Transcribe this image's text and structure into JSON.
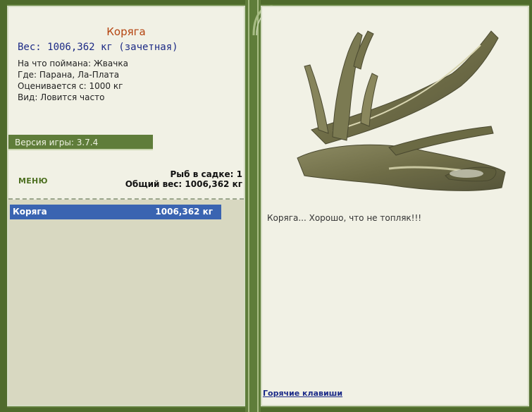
{
  "fish": {
    "title": "Коряга",
    "weight_line": "Вес: 1006,362 кг (зачетная)",
    "caught_on": "На что поймана: Жвачка",
    "location": "Где: Парана, Ла-Плата",
    "valued_from": "Оценивается с: 1000 кг",
    "frequency": "Вид: Ловится часто",
    "description": "Коряга... Хорошо, что не топляк!!!"
  },
  "version": {
    "label": "Версия игры: 3.7.4"
  },
  "menu": {
    "label": "МЕНЮ"
  },
  "keepnet": {
    "fish_count": "Рыб в садке: 1",
    "total_weight": "Общий вес: 1006,362 кг",
    "items": [
      {
        "name": "Коряга",
        "weight": "1006,362 кг"
      }
    ]
  },
  "hotkeys": {
    "label": "Горячие клавиши"
  },
  "colors": {
    "frame_green": "#5f7d3a",
    "panel_bg": "#f1f1e5",
    "list_bg": "#d8d8c1",
    "selected_row": "#3a64b1",
    "title_orange": "#b4430f",
    "weight_blue": "#1c2a86"
  },
  "icons": {
    "ornament": "vine-curl-icon",
    "image": "driftwood-image"
  }
}
